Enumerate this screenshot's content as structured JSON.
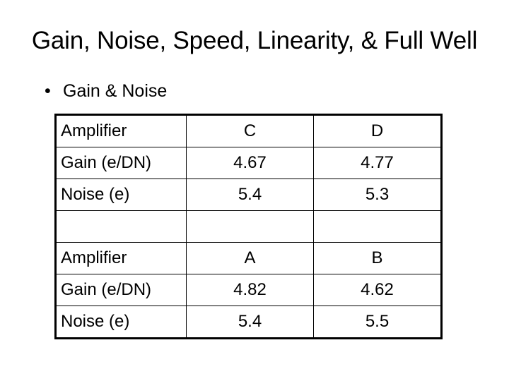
{
  "slide": {
    "title": "Gain, Noise, Speed, Linearity, & Full Well",
    "bullets": [
      {
        "marker": "•",
        "text": "Gain & Noise"
      }
    ]
  },
  "table": {
    "rows": [
      {
        "label": "Amplifier",
        "values": [
          "C",
          "D"
        ]
      },
      {
        "label": "Gain (e/DN)",
        "values": [
          "4.67",
          "4.77"
        ]
      },
      {
        "label": "Noise (e)",
        "values": [
          "5.4",
          "5.3"
        ]
      },
      {
        "label": "",
        "values": [
          "",
          ""
        ]
      },
      {
        "label": "Amplifier",
        "values": [
          "A",
          "B"
        ]
      },
      {
        "label": "Gain (e/DN)",
        "values": [
          "4.82",
          "4.62"
        ]
      },
      {
        "label": "Noise (e)",
        "values": [
          "5.4",
          "5.5"
        ]
      }
    ]
  }
}
